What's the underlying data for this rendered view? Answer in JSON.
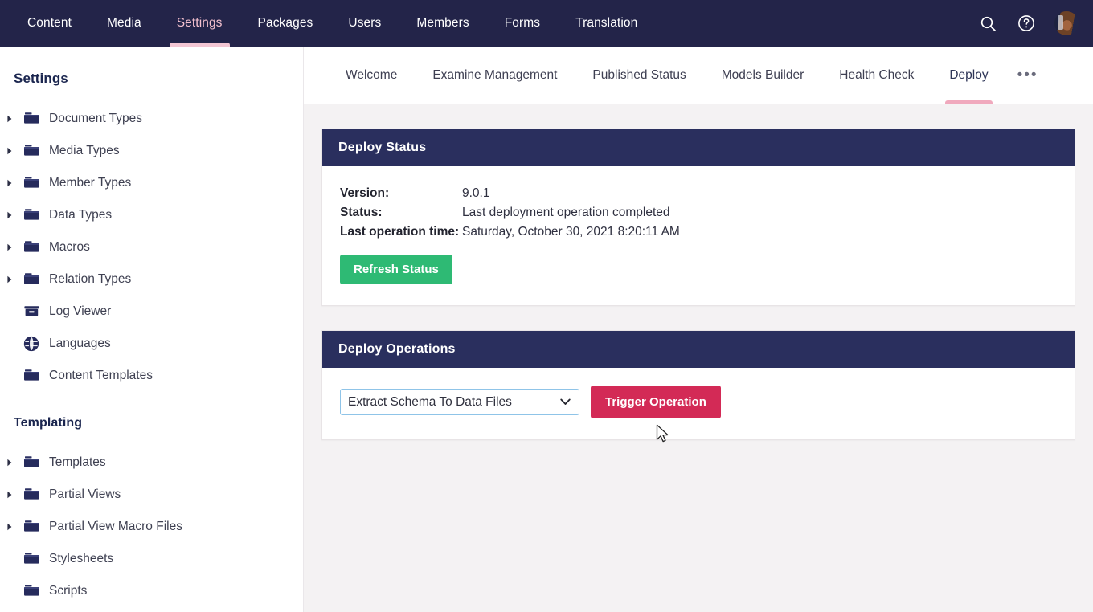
{
  "topnav": {
    "items": [
      {
        "label": "Content",
        "active": false
      },
      {
        "label": "Media",
        "active": false
      },
      {
        "label": "Settings",
        "active": true
      },
      {
        "label": "Packages",
        "active": false
      },
      {
        "label": "Users",
        "active": false
      },
      {
        "label": "Members",
        "active": false
      },
      {
        "label": "Forms",
        "active": false
      },
      {
        "label": "Translation",
        "active": false
      }
    ],
    "search_icon": "search-icon",
    "help_icon": "help-circle-icon",
    "avatar": "user-avatar"
  },
  "sidebar": {
    "title": "Settings",
    "items": [
      {
        "label": "Document Types",
        "icon": "folder-icon",
        "expandable": true
      },
      {
        "label": "Media Types",
        "icon": "folder-icon",
        "expandable": true
      },
      {
        "label": "Member Types",
        "icon": "folder-icon",
        "expandable": true
      },
      {
        "label": "Data Types",
        "icon": "folder-icon",
        "expandable": true
      },
      {
        "label": "Macros",
        "icon": "folder-icon",
        "expandable": true
      },
      {
        "label": "Relation Types",
        "icon": "folder-icon",
        "expandable": true
      },
      {
        "label": "Log Viewer",
        "icon": "archive-box-icon",
        "expandable": false
      },
      {
        "label": "Languages",
        "icon": "globe-icon",
        "expandable": false
      },
      {
        "label": "Content Templates",
        "icon": "folder-icon",
        "expandable": false
      }
    ],
    "section_title": "Templating",
    "templating_items": [
      {
        "label": "Templates",
        "icon": "folder-icon",
        "expandable": true
      },
      {
        "label": "Partial Views",
        "icon": "folder-icon",
        "expandable": true
      },
      {
        "label": "Partial View Macro Files",
        "icon": "folder-icon",
        "expandable": true
      },
      {
        "label": "Stylesheets",
        "icon": "folder-icon",
        "expandable": false
      },
      {
        "label": "Scripts",
        "icon": "folder-icon",
        "expandable": false
      }
    ]
  },
  "subnav": {
    "items": [
      {
        "label": "Welcome",
        "active": false
      },
      {
        "label": "Examine Management",
        "active": false
      },
      {
        "label": "Published Status",
        "active": false
      },
      {
        "label": "Models Builder",
        "active": false
      },
      {
        "label": "Health Check",
        "active": false
      },
      {
        "label": "Deploy",
        "active": true
      }
    ],
    "more_label": "•••"
  },
  "deploy_status": {
    "title": "Deploy Status",
    "rows": [
      {
        "key": "Version:",
        "value": "9.0.1"
      },
      {
        "key": "Status:",
        "value": "Last deployment operation completed"
      },
      {
        "key": "Last operation time:",
        "value": "Saturday, October 30, 2021 8:20:11 AM"
      }
    ],
    "refresh_label": "Refresh Status"
  },
  "deploy_operations": {
    "title": "Deploy Operations",
    "selected_operation": "Extract Schema To Data Files",
    "options": [
      "Extract Schema To Data Files"
    ],
    "trigger_label": "Trigger Operation"
  },
  "colors": {
    "topnav_bg": "#232449",
    "panel_header_bg": "#2a2f5e",
    "accent_pink": "#f0a9bd",
    "green_button": "#2eba74",
    "pink_button": "#d32a56",
    "content_bg": "#f4f2f3",
    "select_focus_border": "#8fc4e8"
  }
}
